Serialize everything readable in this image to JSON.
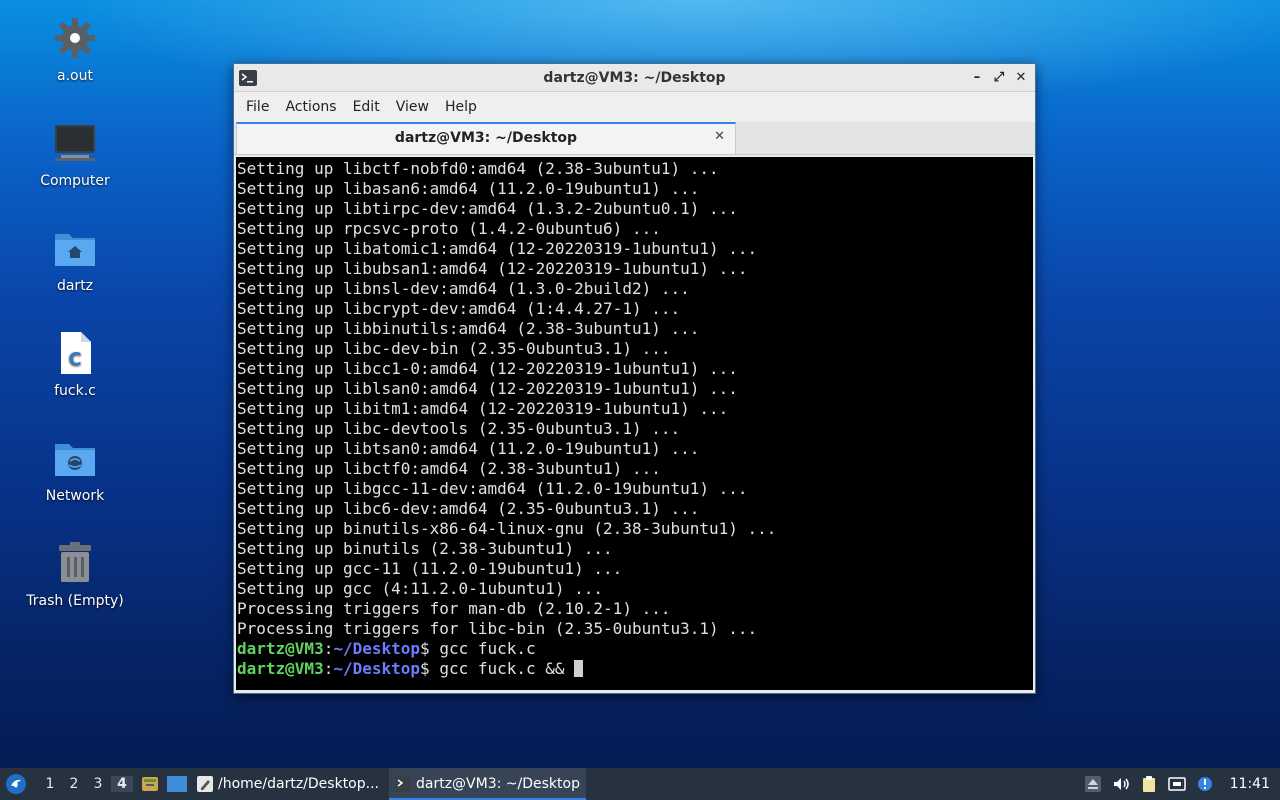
{
  "desktop_icons": [
    {
      "label": "a.out",
      "icon": "gear-icon"
    },
    {
      "label": "Computer",
      "icon": "monitor-icon"
    },
    {
      "label": "dartz",
      "icon": "home-folder-icon"
    },
    {
      "label": "fuck.c",
      "icon": "c-source-file-icon"
    },
    {
      "label": "Network",
      "icon": "network-folder-icon"
    },
    {
      "label": "Trash (Empty)",
      "icon": "trash-icon"
    }
  ],
  "window": {
    "title": "dartz@VM3: ~/Desktop",
    "menu": [
      "File",
      "Actions",
      "Edit",
      "View",
      "Help"
    ],
    "tab_label": "dartz@VM3: ~/Desktop",
    "controls": {
      "minimize": "–",
      "maximize": "⤢",
      "close": "✕"
    }
  },
  "terminal": {
    "colors": {
      "background": "#000000",
      "text": "#e0e0e0",
      "user": "#5fd35f",
      "path": "#6c7cff"
    },
    "output_lines": [
      "Setting up libctf-nobfd0:amd64 (2.38-3ubuntu1) ...",
      "Setting up libasan6:amd64 (11.2.0-19ubuntu1) ...",
      "Setting up libtirpc-dev:amd64 (1.3.2-2ubuntu0.1) ...",
      "Setting up rpcsvc-proto (1.4.2-0ubuntu6) ...",
      "Setting up libatomic1:amd64 (12-20220319-1ubuntu1) ...",
      "Setting up libubsan1:amd64 (12-20220319-1ubuntu1) ...",
      "Setting up libnsl-dev:amd64 (1.3.0-2build2) ...",
      "Setting up libcrypt-dev:amd64 (1:4.4.27-1) ...",
      "Setting up libbinutils:amd64 (2.38-3ubuntu1) ...",
      "Setting up libc-dev-bin (2.35-0ubuntu3.1) ...",
      "Setting up libcc1-0:amd64 (12-20220319-1ubuntu1) ...",
      "Setting up liblsan0:amd64 (12-20220319-1ubuntu1) ...",
      "Setting up libitm1:amd64 (12-20220319-1ubuntu1) ...",
      "Setting up libc-devtools (2.35-0ubuntu3.1) ...",
      "Setting up libtsan0:amd64 (11.2.0-19ubuntu1) ...",
      "Setting up libctf0:amd64 (2.38-3ubuntu1) ...",
      "Setting up libgcc-11-dev:amd64 (11.2.0-19ubuntu1) ...",
      "Setting up libc6-dev:amd64 (2.35-0ubuntu3.1) ...",
      "Setting up binutils-x86-64-linux-gnu (2.38-3ubuntu1) ...",
      "Setting up binutils (2.38-3ubuntu1) ...",
      "Setting up gcc-11 (11.2.0-19ubuntu1) ...",
      "Setting up gcc (4:11.2.0-1ubuntu1) ...",
      "Processing triggers for man-db (2.10.2-1) ...",
      "Processing triggers for libc-bin (2.35-0ubuntu3.1) ..."
    ],
    "prompts": [
      {
        "user": "dartz@VM3",
        "sep": ":",
        "path": "~/Desktop",
        "symbol": "$ ",
        "command": "gcc fuck.c"
      },
      {
        "user": "dartz@VM3",
        "sep": ":",
        "path": "~/Desktop",
        "symbol": "$ ",
        "command": "gcc fuck.c && "
      }
    ]
  },
  "taskbar": {
    "workspaces": [
      "1",
      "2",
      "3",
      "4"
    ],
    "active_workspace": "4",
    "tasks": [
      {
        "label": "/home/dartz/Desktop...",
        "icon": "text-editor-icon",
        "active": false
      },
      {
        "label": "dartz@VM3: ~/Desktop",
        "icon": "terminal-icon",
        "active": true
      }
    ],
    "clock": "11:41"
  }
}
